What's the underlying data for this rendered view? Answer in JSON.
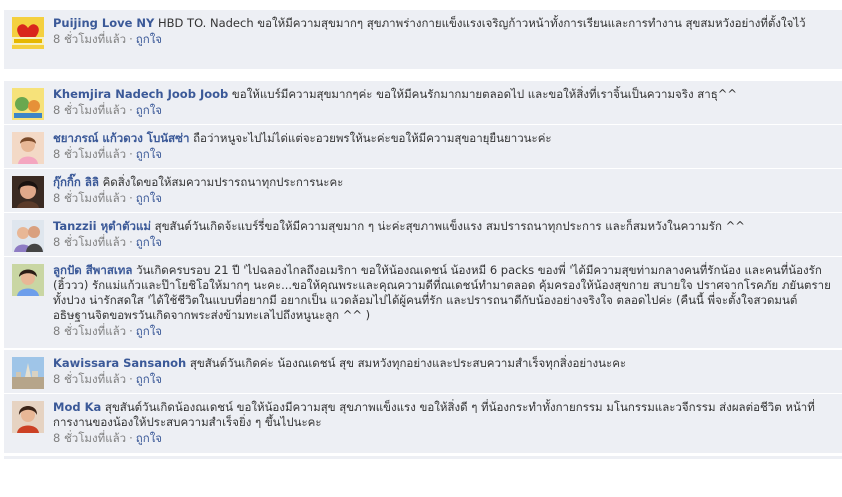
{
  "comments": [
    {
      "author": "Puijing Love NY",
      "text": "HBD TO. Nadech ขอให้มีความสุขมากๆ สุขภาพร่างกายแข็งแรงเจริญก้าวหน้าทั้งการเรียนและการทำงาน สุขสมหวังอย่างที่ตั้งใจไว้",
      "time": "8 ชั่วโมงที่แล้ว",
      "sep": "·",
      "like": "ถูกใจ",
      "avatar_icon": "avatar-heart-logo-icon"
    },
    {
      "author": "Khemjira Nadech Joob Joob",
      "text": "ขอให้แบร์มีความสุขมากๆค่ะ ขอให้มีคนรักมากมายตลอดไป และขอให้สิ่งที่เราจิ้นเป็นความจริง สาธุ^^",
      "time": "8 ชั่วโมงที่แล้ว",
      "sep": "·",
      "like": "ถูกใจ",
      "avatar_icon": "avatar-cartoon-icon"
    },
    {
      "author": "ชยาภรณ์ แก้วดวง โบนัสซ่า",
      "text": "ถือว่าหนูจะไปไม่ได่แต่จะอวยพรให้นะค่ะขอให้มีความสุขอายุยืนยาวนะค่ะ",
      "time": "8 ชั่วโมงที่แล้ว",
      "sep": "·",
      "like": "ถูกใจ",
      "avatar_icon": "avatar-photo-icon"
    },
    {
      "author": "กุ๊กกิ๊ก ลิลิ",
      "text": "คิดสิ่งใดขอให้สมความปรารถนาทุกประการนะคะ",
      "time": "8 ชั่วโมงที่แล้ว",
      "sep": "·",
      "like": "ถูกใจ",
      "avatar_icon": "avatar-photo-icon"
    },
    {
      "author": "Tanzzii หุตำตัวแม่",
      "text": "สุขสันต์วันเกิดจ้ะแบร์รี่ขอให้มีความสุขมาก ๆ น่ะค่ะสุขภาพแข็งแรง สมปรารถนาทุกประการ และก็สมหวังในความรัก ^^",
      "time": "8 ชั่วโมงที่แล้ว",
      "sep": "·",
      "like": "ถูกใจ",
      "avatar_icon": "avatar-photo-icon"
    },
    {
      "author": "ลูกปัด สีพาสเทล",
      "text": "วันเกิดครบรอบ 21 ปี 'ไปฉลองไกลถึงอเมริกา ขอให้น้องณเดชน์ น้องหมี 6 packs ของพี่ 'ได้มีความสุขท่ามกลางคนที่รักน้อง และคนที่น้องรัก (ฮิ้ววว) รักแม่แก้วและป๊าโยชิโอให้มากๆ นะคะ...ขอให้คุณพระและคุณความดีที่ณเดชน์ทำมาตลอด คุ้มครองให้น้องสุขกาย สบายใจ ปราศจากโรคภัย ภยันตรายทั้งปวง น่ารักสดใส 'ได้ใช้ชีวิตในแบบที่อยากมี อยากเป็น แวดล้อมไปได้ผู้คนที่รัก และปรารถนาดีกับน้องอย่างจริงใจ ตลอดไปค่ะ (คืนนี้ พี่จะตั้งใจสวดมนต์ อธิษฐานจิตขอพรวันเกิดจากพระส่งข้ามทะเลไปถึงหนูนะลูก ^^ )",
      "time": "8 ชั่วโมงที่แล้ว",
      "sep": "·",
      "like": "ถูกใจ",
      "avatar_icon": "avatar-photo-icon"
    },
    {
      "author": "Kawissara Sansanoh",
      "text": "สุขสันต์วันเกิดค่ะ น้องณเดชน์ สุข สมหวังทุกอย่างและประสบความสำเร็จทุกสิ่งอย่างนะคะ",
      "time": "8 ชั่วโมงที่แล้ว",
      "sep": "·",
      "like": "ถูกใจ",
      "avatar_icon": "avatar-landscape-icon"
    },
    {
      "author": "Mod Ka",
      "text": "สุขสันต์วันเกิดน้องณเดชน์ ขอให้น้องมีความสุข สุขภาพแข็งแรง ขอให้สิ่งดี ๆ ที่น้องกระทำทั้งกายกรรม มโนกรรมและวจีกรรม ส่งผลต่อชีวิต หน้าที่ การงานของน้องให้ประสบความสำเร็จยิ่ง ๆ ขึ้นไปนะคะ",
      "time": "8 ชั่วโมงที่แล้ว",
      "sep": "·",
      "like": "ถูกใจ",
      "avatar_icon": "avatar-photo-icon"
    }
  ],
  "colors": {
    "author": "#3b5998",
    "comment_bg": "#edeff4",
    "meta": "#808080",
    "text": "#333333"
  }
}
